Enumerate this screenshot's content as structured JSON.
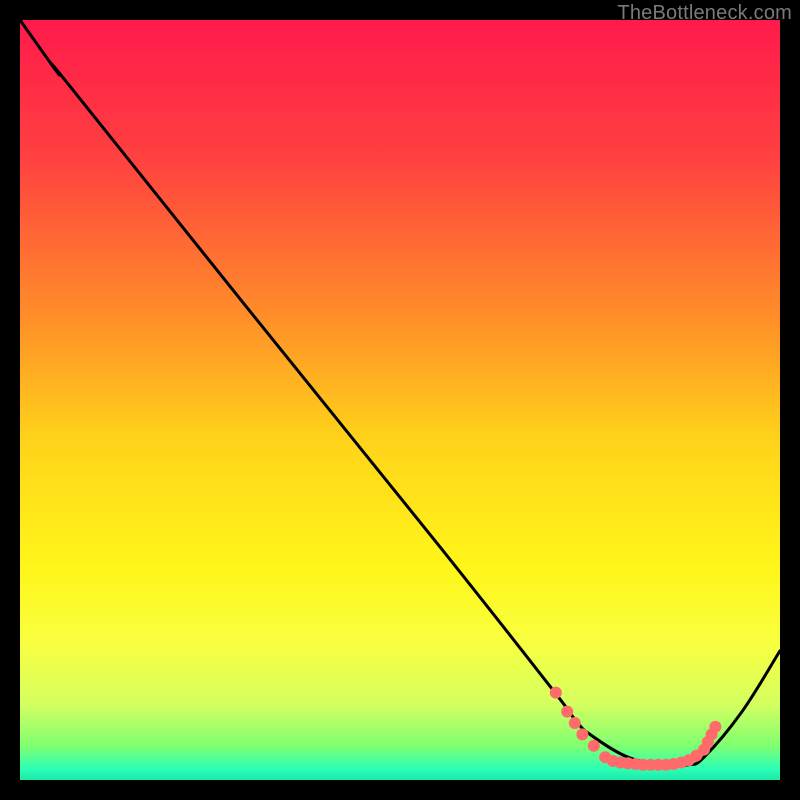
{
  "watermark": "TheBottleneck.com",
  "chart_data": {
    "type": "line",
    "title": "",
    "xlabel": "",
    "ylabel": "",
    "xlim": [
      0,
      100
    ],
    "ylim": [
      0,
      100
    ],
    "background_gradient": {
      "type": "vertical",
      "stops": [
        {
          "pos": 0.0,
          "color": "#ff1a4b"
        },
        {
          "pos": 0.18,
          "color": "#ff4040"
        },
        {
          "pos": 0.38,
          "color": "#ff8a2a"
        },
        {
          "pos": 0.55,
          "color": "#ffd21a"
        },
        {
          "pos": 0.72,
          "color": "#fff61a"
        },
        {
          "pos": 0.82,
          "color": "#f8ff40"
        },
        {
          "pos": 0.9,
          "color": "#d4ff60"
        },
        {
          "pos": 0.955,
          "color": "#7fff70"
        },
        {
          "pos": 0.985,
          "color": "#2dffb5"
        },
        {
          "pos": 1.0,
          "color": "#19e9ab"
        }
      ]
    },
    "series": [
      {
        "name": "curve",
        "color": "#000000",
        "x": [
          0,
          5,
          6,
          30,
          55,
          70,
          73,
          75,
          80,
          85,
          88,
          90,
          95,
          100
        ],
        "y": [
          100,
          93,
          92,
          62,
          31,
          12,
          8,
          6,
          3,
          2,
          2,
          3,
          9,
          17
        ]
      }
    ],
    "highlight_dots": {
      "color": "#ff6b6b",
      "radius": 6,
      "points": [
        {
          "x": 70.5,
          "y": 11.5
        },
        {
          "x": 72.0,
          "y": 9.0
        },
        {
          "x": 73.0,
          "y": 7.5
        },
        {
          "x": 74.0,
          "y": 6.0
        },
        {
          "x": 75.5,
          "y": 4.5
        },
        {
          "x": 77.0,
          "y": 3.0
        },
        {
          "x": 78.0,
          "y": 2.5
        },
        {
          "x": 79.0,
          "y": 2.3
        },
        {
          "x": 80.0,
          "y": 2.2
        },
        {
          "x": 81.0,
          "y": 2.1
        },
        {
          "x": 82.0,
          "y": 2.0
        },
        {
          "x": 83.0,
          "y": 2.0
        },
        {
          "x": 84.0,
          "y": 2.0
        },
        {
          "x": 85.0,
          "y": 2.0
        },
        {
          "x": 86.0,
          "y": 2.1
        },
        {
          "x": 87.0,
          "y": 2.3
        },
        {
          "x": 88.0,
          "y": 2.6
        },
        {
          "x": 89.0,
          "y": 3.2
        },
        {
          "x": 90.0,
          "y": 4.0
        },
        {
          "x": 90.5,
          "y": 5.0
        },
        {
          "x": 91.0,
          "y": 6.0
        },
        {
          "x": 91.5,
          "y": 7.0
        }
      ]
    }
  }
}
